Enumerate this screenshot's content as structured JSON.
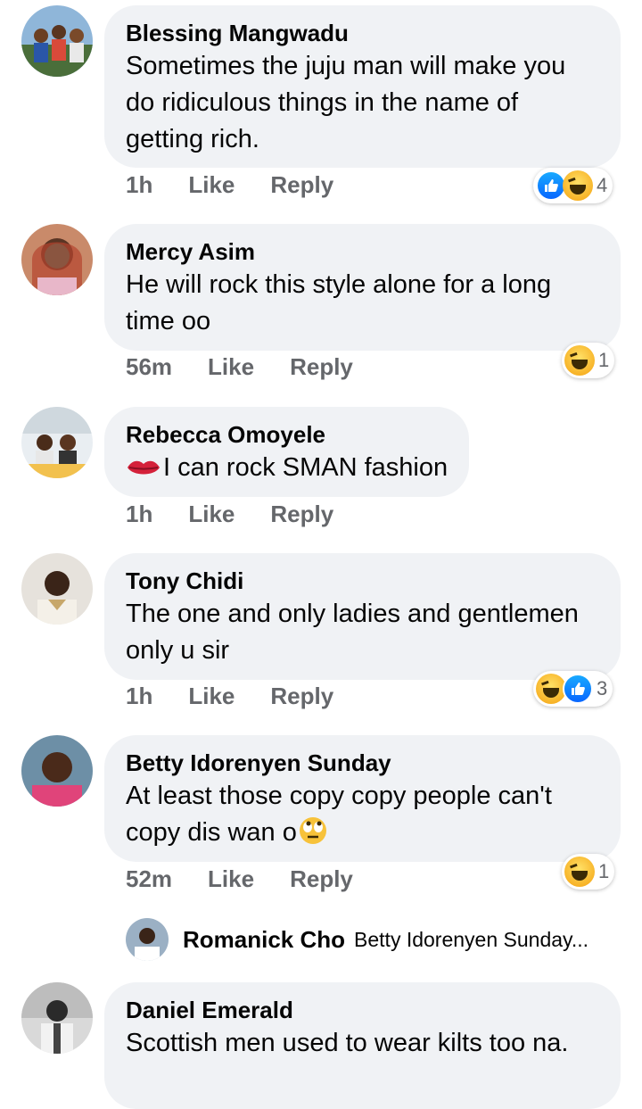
{
  "comments": [
    {
      "author": "Blessing Mangwadu",
      "text": "Sometimes the juju man will make you do ridiculous things in the name of getting rich.",
      "time": "1h",
      "like": "Like",
      "reply": "Reply",
      "reaction_count": "4",
      "reactions": [
        "like-icon",
        "haha-icon"
      ]
    },
    {
      "author": "Mercy Asim",
      "text": "He will rock this style alone for a long time oo",
      "time": "56m",
      "like": "Like",
      "reply": "Reply",
      "reaction_count": "1",
      "reactions": [
        "haha-icon"
      ]
    },
    {
      "author": "Rebecca Omoyele",
      "text": "I can rock SMAN fashion",
      "time": "1h",
      "like": "Like",
      "reply": "Reply"
    },
    {
      "author": "Tony Chidi",
      "text": "The one and only ladies and gentlemen only u sir",
      "time": "1h",
      "like": "Like",
      "reply": "Reply",
      "reaction_count": "3",
      "reactions": [
        "haha-icon",
        "like-icon"
      ]
    },
    {
      "author": "Betty Idorenyen Sunday",
      "text": "At least those copy copy people can't copy dis wan o",
      "time": "52m",
      "like": "Like",
      "reply": "Reply",
      "reaction_count": "1",
      "reactions": [
        "haha-icon"
      ],
      "reply_preview": {
        "author": "Romanick Cho",
        "text": "Betty Idorenyen Sunday..."
      }
    },
    {
      "author": "Daniel Emerald",
      "text": "Scottish men used to wear kilts too na."
    }
  ]
}
